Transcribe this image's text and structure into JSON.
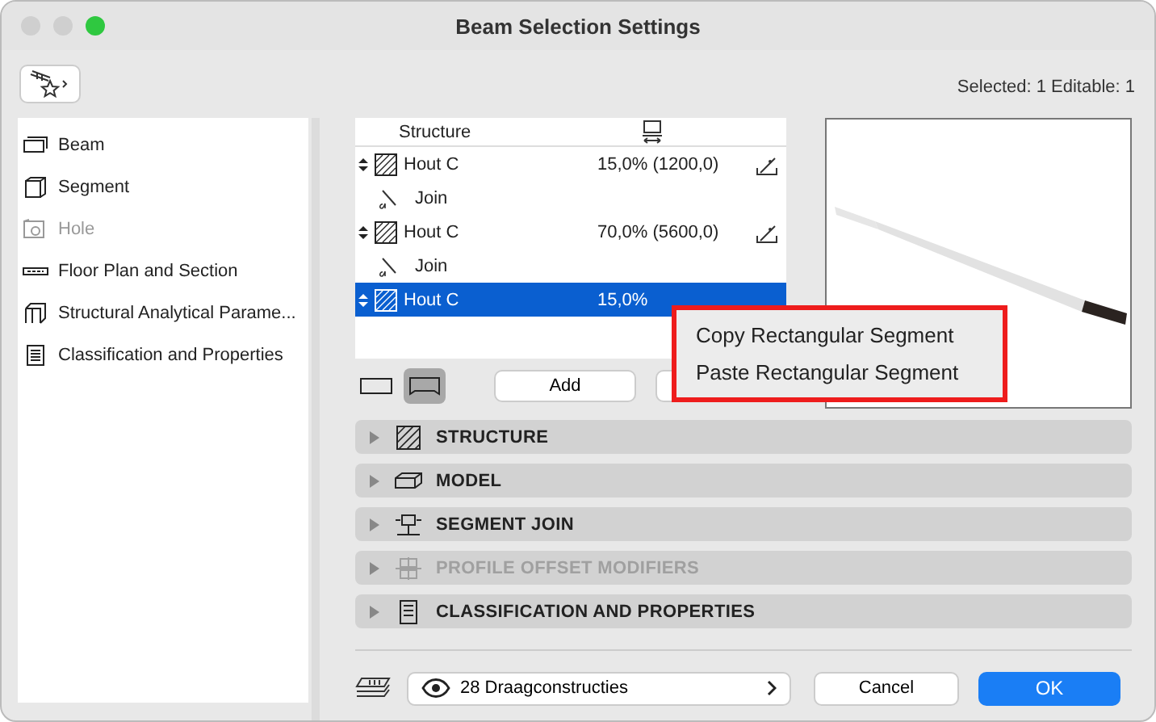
{
  "window": {
    "title": "Beam Selection Settings"
  },
  "selection_info": "Selected: 1 Editable: 1",
  "sidebar": {
    "items": [
      {
        "label": "Beam",
        "disabled": false
      },
      {
        "label": "Segment",
        "disabled": false
      },
      {
        "label": "Hole",
        "disabled": true
      },
      {
        "label": "Floor Plan and Section",
        "disabled": false
      },
      {
        "label": "Structural Analytical Parame...",
        "disabled": false
      },
      {
        "label": "Classification and Properties",
        "disabled": false
      }
    ]
  },
  "table": {
    "columns": [
      "Structure"
    ],
    "rows": [
      {
        "kind": "segment",
        "name": "Hout C",
        "value": "15,0% (1200,0)",
        "selected": false
      },
      {
        "kind": "join",
        "name": "Join",
        "selected": false
      },
      {
        "kind": "segment",
        "name": "Hout C",
        "value": "70,0% (5600,0)",
        "selected": false
      },
      {
        "kind": "join",
        "name": "Join",
        "selected": false
      },
      {
        "kind": "segment",
        "name": "Hout C",
        "value": "15,0%",
        "selected": true
      }
    ]
  },
  "shape_toggle": [
    {
      "selected": false
    },
    {
      "selected": true
    }
  ],
  "add_button": "Add",
  "context_menu": [
    "Copy Rectangular Segment",
    "Paste Rectangular Segment"
  ],
  "sections": [
    {
      "title": "STRUCTURE",
      "disabled": false
    },
    {
      "title": "MODEL",
      "disabled": false
    },
    {
      "title": "SEGMENT JOIN",
      "disabled": false
    },
    {
      "title": "PROFILE OFFSET MODIFIERS",
      "disabled": true
    },
    {
      "title": "CLASSIFICATION AND PROPERTIES",
      "disabled": false
    }
  ],
  "layer": "28 Draagconstructies",
  "buttons": {
    "cancel": "Cancel",
    "ok": "OK"
  }
}
